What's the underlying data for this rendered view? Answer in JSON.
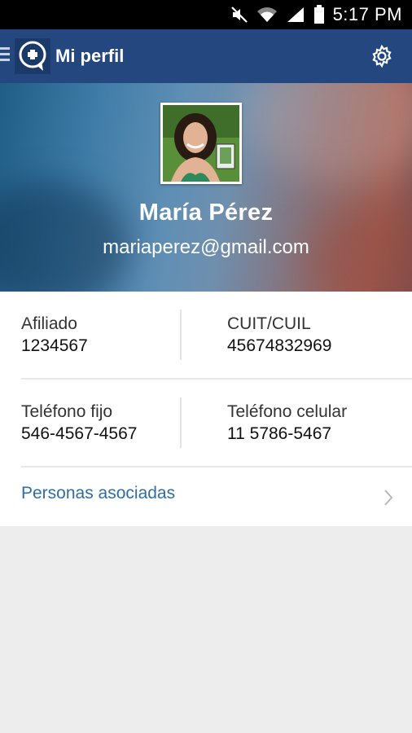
{
  "status_bar": {
    "time": "5:17 PM",
    "icons": [
      "mute-icon",
      "wifi-icon",
      "signal-icon",
      "battery-icon"
    ]
  },
  "app_bar": {
    "title": "Mi perfil",
    "logo_icon": "medical-plus-logo-icon",
    "settings_icon": "gear-icon",
    "color": "#23477e"
  },
  "profile": {
    "name": "María Pérez",
    "email": "mariaperez@gmail.com",
    "avatar_icon": "profile-photo"
  },
  "details": {
    "afiliado_label": "Afiliado",
    "afiliado_value": "1234567",
    "cuit_label": "CUIT/CUIL",
    "cuit_value": "45674832969",
    "telefono_fijo_label": "Teléfono fijo",
    "telefono_fijo_value": "546-4567-4567",
    "telefono_celular_label": "Teléfono celular",
    "telefono_celular_value": "11 5786-5467"
  },
  "associated": {
    "label": "Personas asociadas",
    "chevron_icon": "chevron-right-icon",
    "color": "#2f6da4"
  }
}
